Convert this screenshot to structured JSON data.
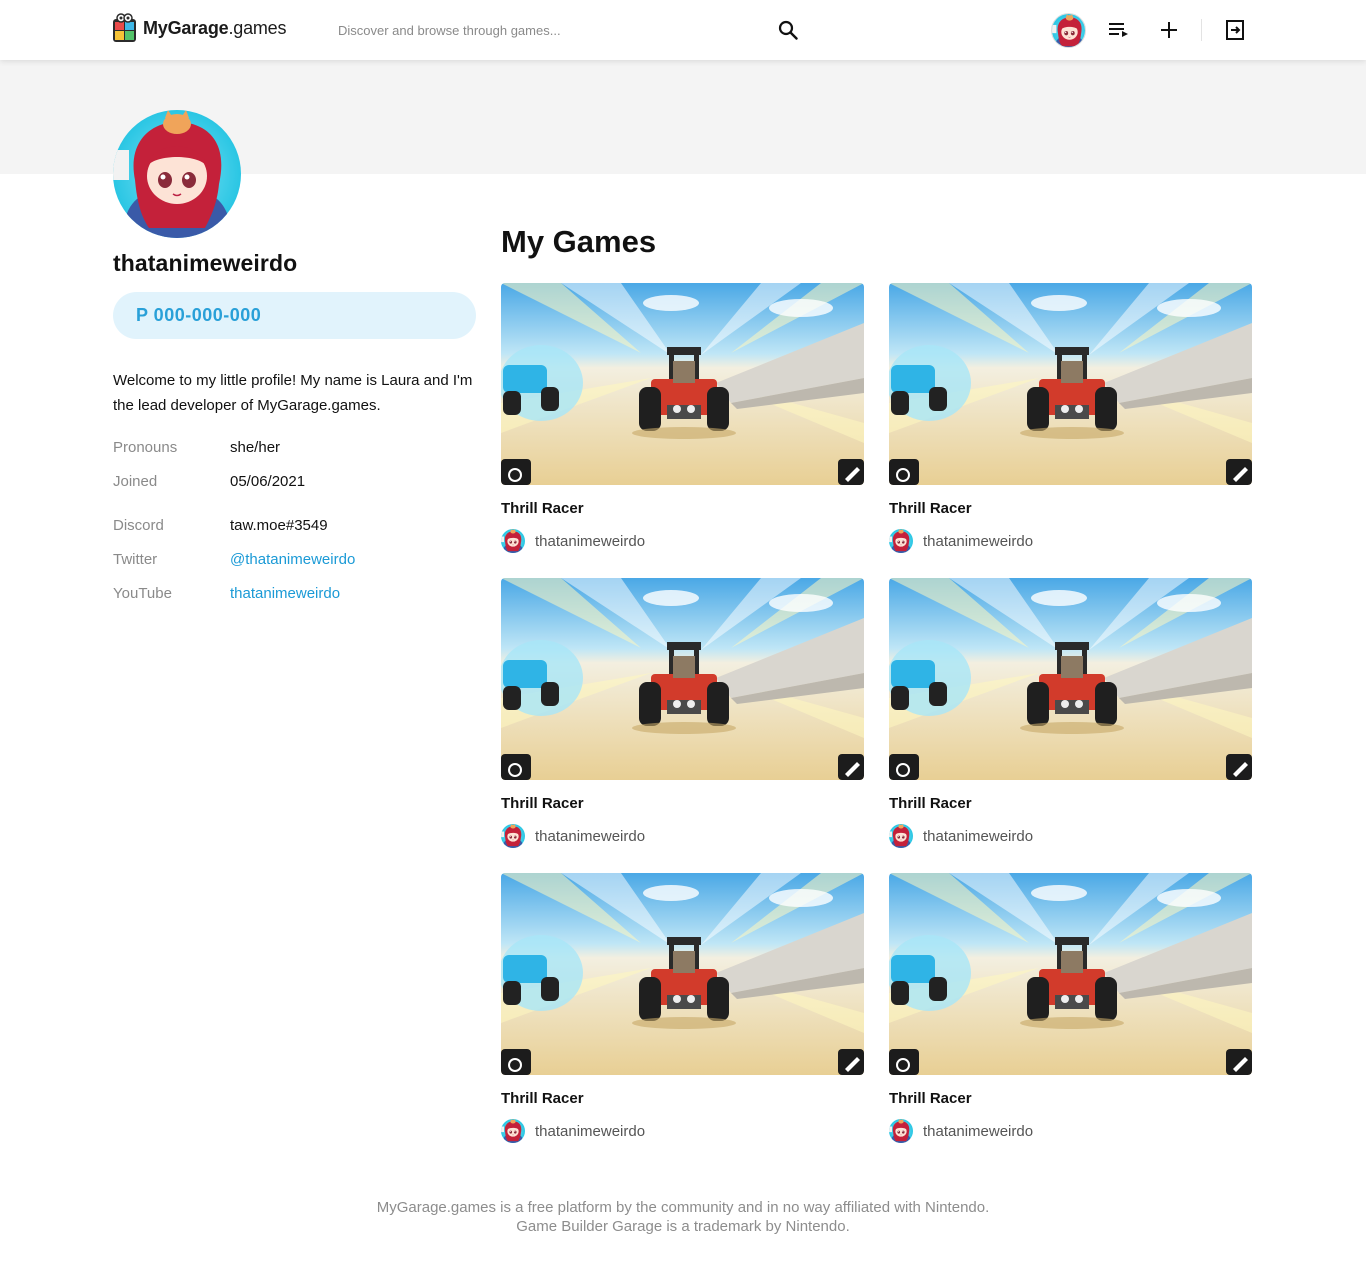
{
  "header": {
    "logo_strong": "MyGarage",
    "logo_light": ".games",
    "search_placeholder": "Discover and browse through games...",
    "icons": [
      "search-icon",
      "playlist-icon",
      "plus-icon",
      "logout-icon"
    ]
  },
  "profile": {
    "username": "thatanimeweirdo",
    "creator_code": "P 000-000-000",
    "bio": "Welcome to my little profile! My name is Laura and I'm the lead developer of MyGarage.games.",
    "pronouns_label": "Pronouns",
    "pronouns": "she/her",
    "joined_label": "Joined",
    "joined": "05/06/2021",
    "discord_label": "Discord",
    "discord": "taw.moe#3549",
    "twitter_label": "Twitter",
    "twitter": "@thatanimeweirdo",
    "youtube_label": "YouTube",
    "youtube": "thatanimeweirdo"
  },
  "games_section": {
    "title": "My Games",
    "games": [
      {
        "title": "Thrill Racer",
        "author": "thatanimeweirdo"
      },
      {
        "title": "Thrill Racer",
        "author": "thatanimeweirdo"
      },
      {
        "title": "Thrill Racer",
        "author": "thatanimeweirdo"
      },
      {
        "title": "Thrill Racer",
        "author": "thatanimeweirdo"
      },
      {
        "title": "Thrill Racer",
        "author": "thatanimeweirdo"
      },
      {
        "title": "Thrill Racer",
        "author": "thatanimeweirdo"
      }
    ]
  },
  "footer": {
    "line1": "MyGarage.games is a free platform by the community and in no way affiliated with Nintendo.",
    "line2": "Game Builder Garage is a trademark by Nintendo."
  },
  "colors": {
    "accent": "#29a0d8",
    "link": "#1b9ad6",
    "pill_bg": "#e1f3fc",
    "banner_bg": "#f4f4f4"
  }
}
